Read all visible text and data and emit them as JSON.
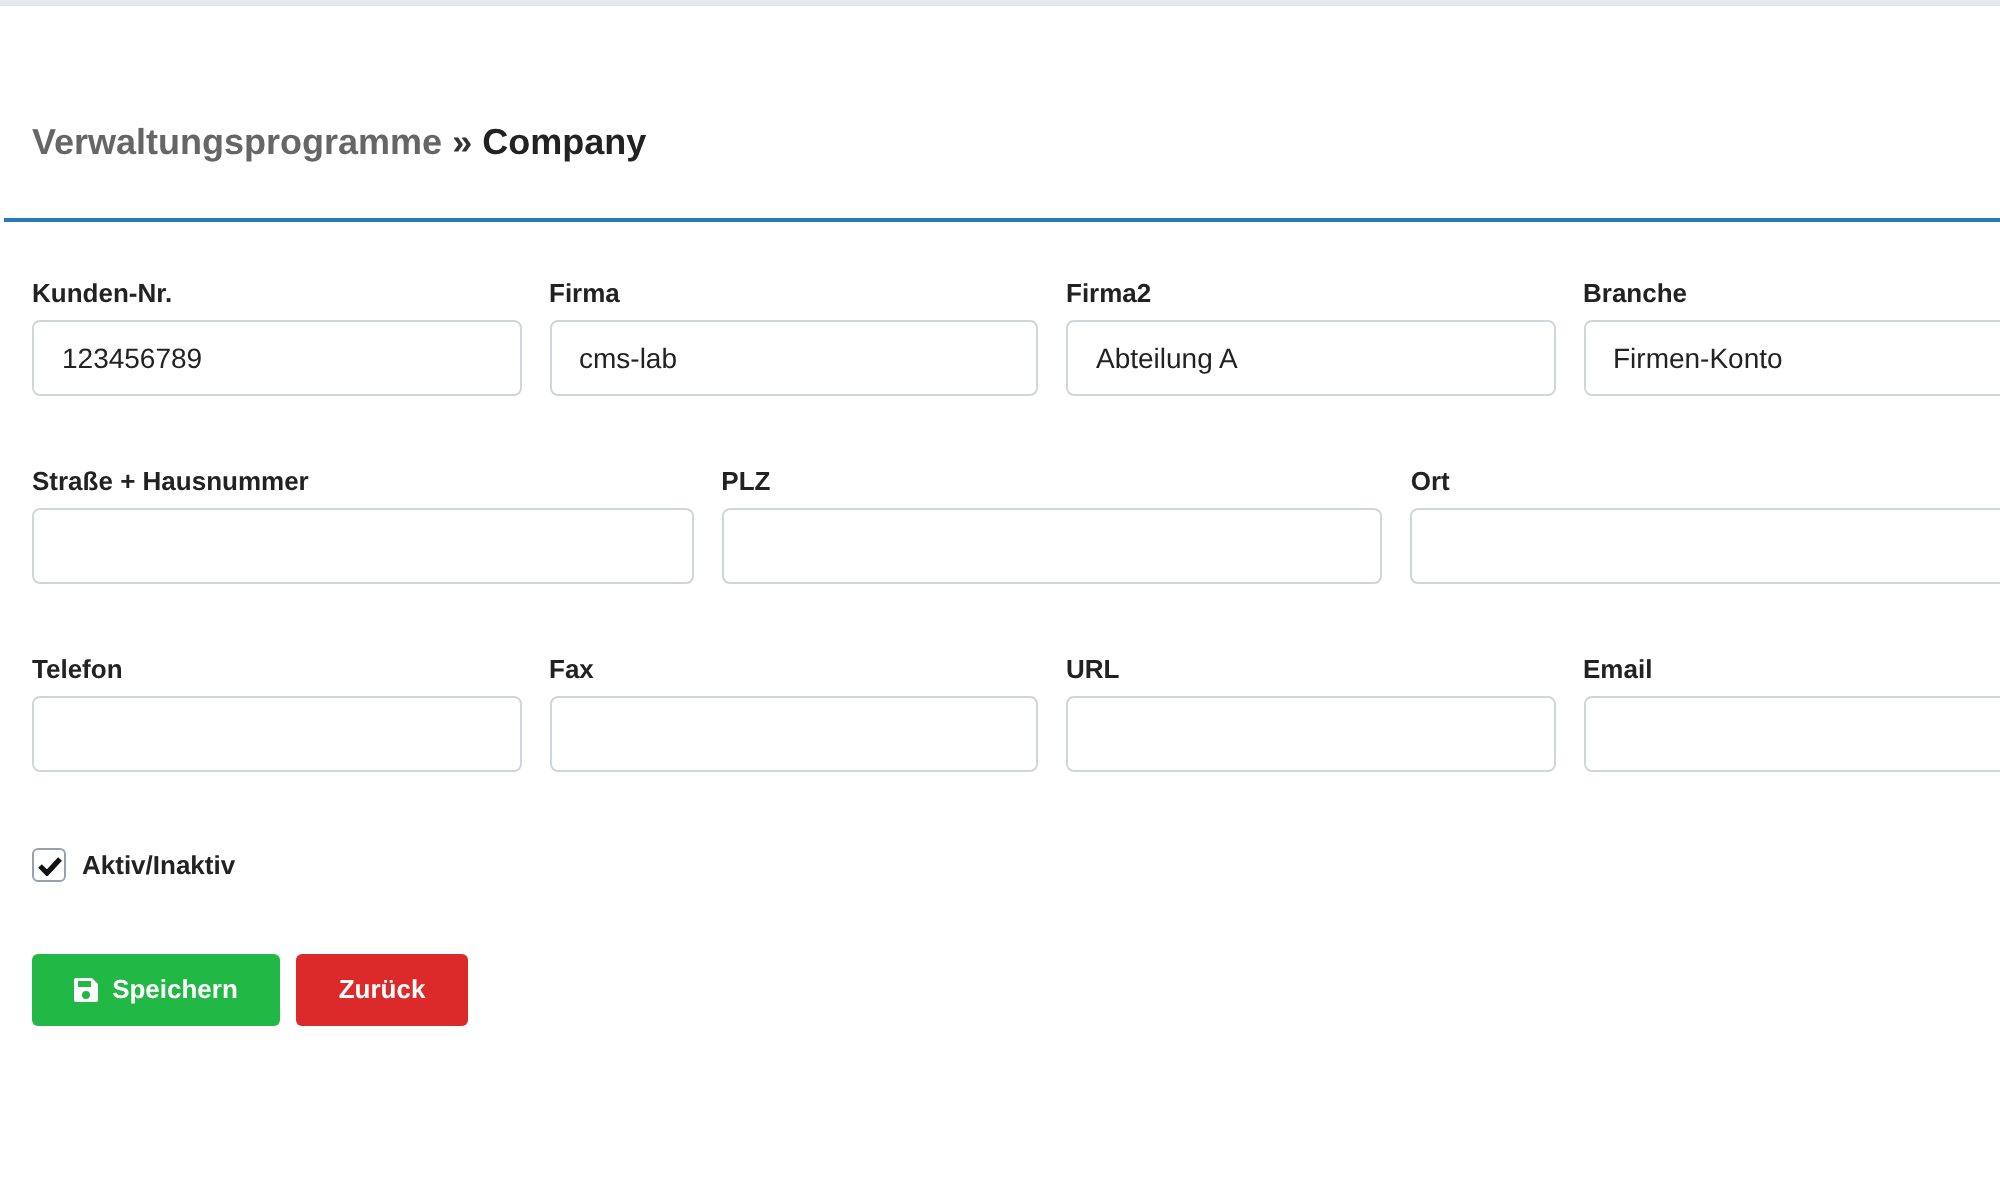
{
  "breadcrumb": {
    "parent": "Verwaltungsprogramme",
    "separator": "»",
    "current": "Company"
  },
  "rows": [
    {
      "fields": [
        {
          "label": "Kunden-Nr.",
          "value": "123456789"
        },
        {
          "label": "Firma",
          "value": "cms-lab"
        },
        {
          "label": "Firma2",
          "value": "Abteilung A"
        },
        {
          "label": "Branche",
          "value": "Firmen-Konto"
        }
      ]
    },
    {
      "fields": [
        {
          "label": "Straße + Hausnummer"
        },
        {
          "label": "PLZ"
        },
        {
          "label": "Ort"
        }
      ]
    },
    {
      "fields": [
        {
          "label": "Telefon"
        },
        {
          "label": "Fax"
        },
        {
          "label": "URL"
        },
        {
          "label": "Email"
        }
      ]
    }
  ],
  "active_checkbox": {
    "label": "Aktiv/Inaktiv",
    "checked": true
  },
  "buttons": [
    {
      "label": "Speichern",
      "kind": "save"
    },
    {
      "label": "Zurück",
      "kind": "back"
    }
  ]
}
